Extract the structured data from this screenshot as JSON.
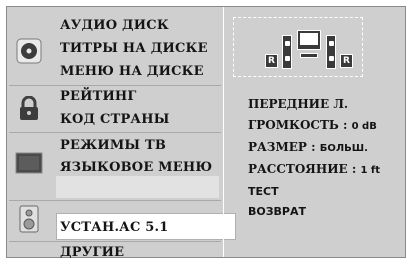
{
  "menu": {
    "groups": [
      {
        "icon": "disc-icon",
        "items": [
          "АУДИО ДИСК",
          "ТИТРЫ НА ДИСКЕ",
          "МЕНЮ НА ДИСКЕ"
        ]
      },
      {
        "icon": "lock-icon",
        "items": [
          "РЕЙТИНГ",
          "КОД СТРАНЫ"
        ]
      },
      {
        "icon": "tv-icon",
        "items": [
          "РЕЖИМЫ ТВ",
          "ЯЗЫКОВОЕ МЕНЮ"
        ]
      },
      {
        "icon": "speaker-icon",
        "items": [
          "УСТАН.АС 5.1"
        ]
      },
      {
        "icon": "other-icon",
        "items": [
          "ДРУГИЕ"
        ]
      }
    ],
    "selected": "УСТАН.АС 5.1"
  },
  "speaker_panel": {
    "diagram": {
      "left_label": "R",
      "right_label": "R",
      "center_label": ""
    },
    "rows": [
      {
        "label": "ПЕРЕДНИЕ Л.",
        "value": ""
      },
      {
        "label": "ГРОМКОСТЬ :",
        "value": "0 dB"
      },
      {
        "label": "РАЗМЕР :",
        "value": "БОЛЬШ."
      },
      {
        "label": "РАССТОЯНИЕ :",
        "value": "1 ft"
      }
    ],
    "test_label": "ТЕСТ",
    "return_label": "ВОЗВРАТ"
  }
}
